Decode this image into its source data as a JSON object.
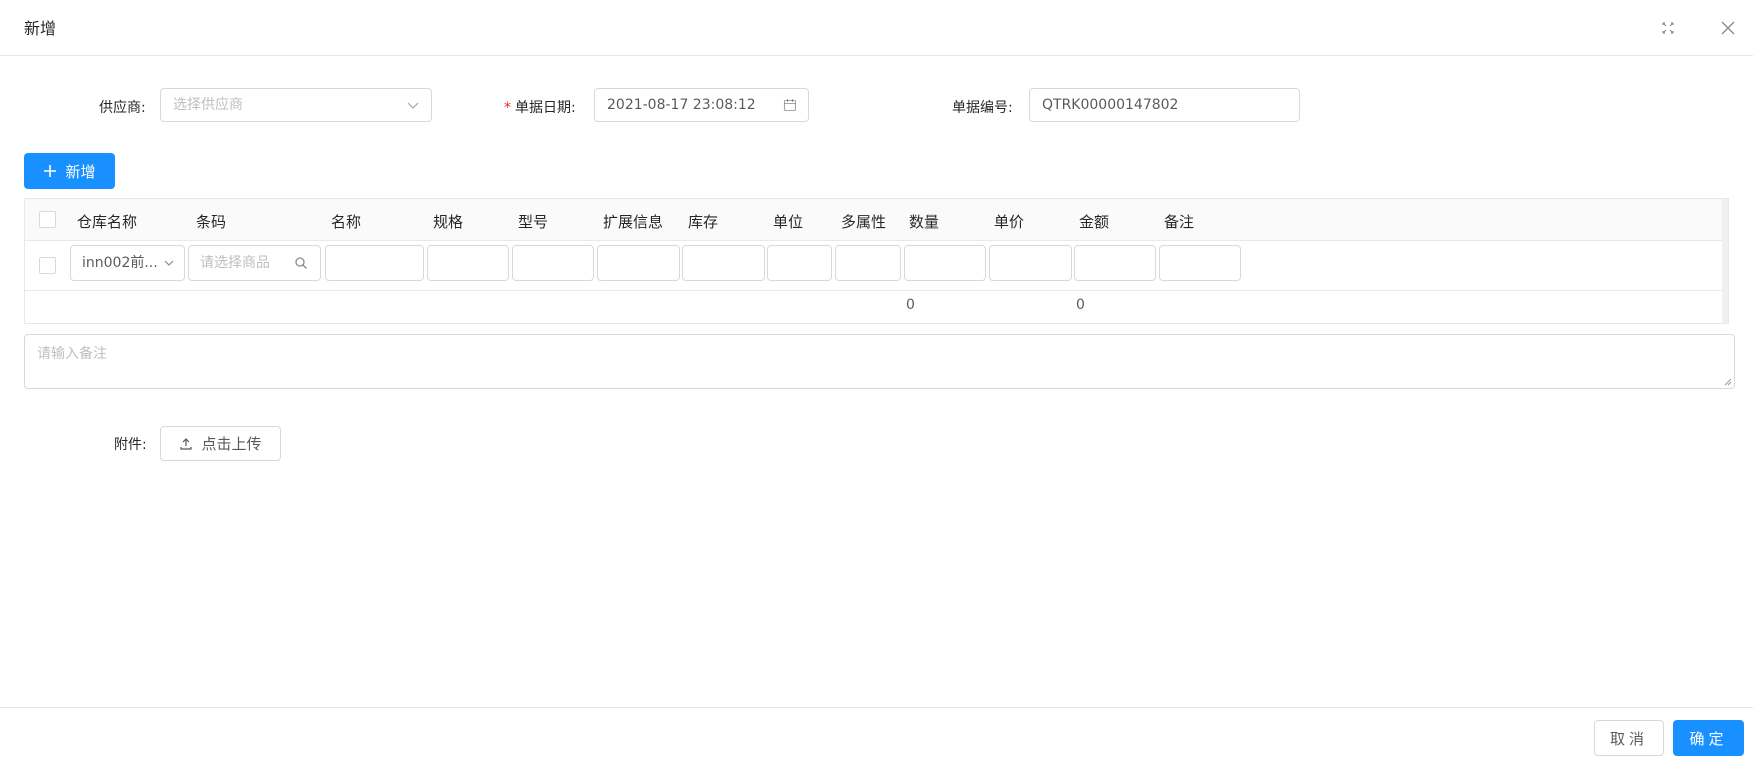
{
  "modal": {
    "title": "新增",
    "fullscreen_icon": "fullscreen-icon",
    "close_icon": "close-icon"
  },
  "form": {
    "supplier": {
      "label": "供应商:",
      "placeholder": "选择供应商",
      "icon": "chevron-down-icon"
    },
    "date": {
      "label": "单据日期:",
      "required_mark": "*",
      "value": "2021-08-17 23:08:12",
      "icon": "calendar-icon"
    },
    "bill_no": {
      "label": "单据编号:",
      "value": "QTRK00000147802"
    }
  },
  "toolbar": {
    "add_label": "新增",
    "add_icon": "plus-icon"
  },
  "table": {
    "columns": [
      "仓库名称",
      "条码",
      "名称",
      "规格",
      "型号",
      "扩展信息",
      "库存",
      "单位",
      "多属性",
      "数量",
      "单价",
      "金额",
      "备注"
    ],
    "row": {
      "warehouse": "inn002前...",
      "barcode_placeholder": "请选择商品"
    },
    "summary": {
      "quantity_total": "0",
      "amount_total": "0"
    }
  },
  "remark": {
    "placeholder": "请输入备注"
  },
  "attachment": {
    "label": "附件:",
    "upload_label": "点击上传",
    "upload_icon": "upload-icon"
  },
  "footer": {
    "cancel_label": "取消",
    "ok_label": "确定"
  },
  "colors": {
    "primary": "#1890ff",
    "required": "#f5222d",
    "border": "#d9d9d9"
  }
}
